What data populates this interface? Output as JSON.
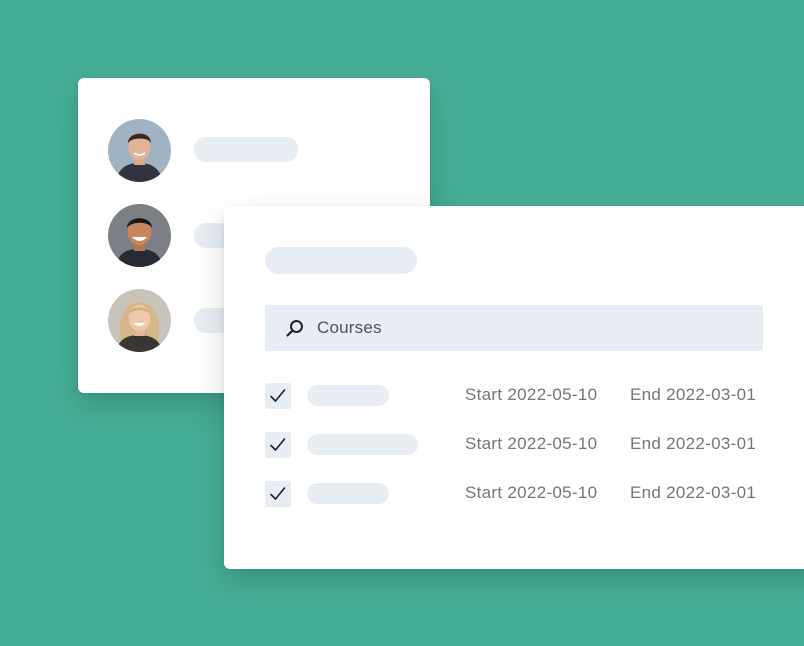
{
  "search": {
    "label": "Courses",
    "icon": "search-icon"
  },
  "courses": {
    "rows": [
      {
        "checked": true,
        "start": "Start 2022-05-10",
        "end": "End 2022-03-01"
      },
      {
        "checked": true,
        "start": "Start 2022-05-10",
        "end": "End 2022-03-01"
      },
      {
        "checked": true,
        "start": "Start 2022-05-10",
        "end": "End 2022-03-01"
      }
    ]
  },
  "colors": {
    "background": "#45ae96",
    "placeholder": "#e8edf4",
    "card": "#ffffff"
  }
}
